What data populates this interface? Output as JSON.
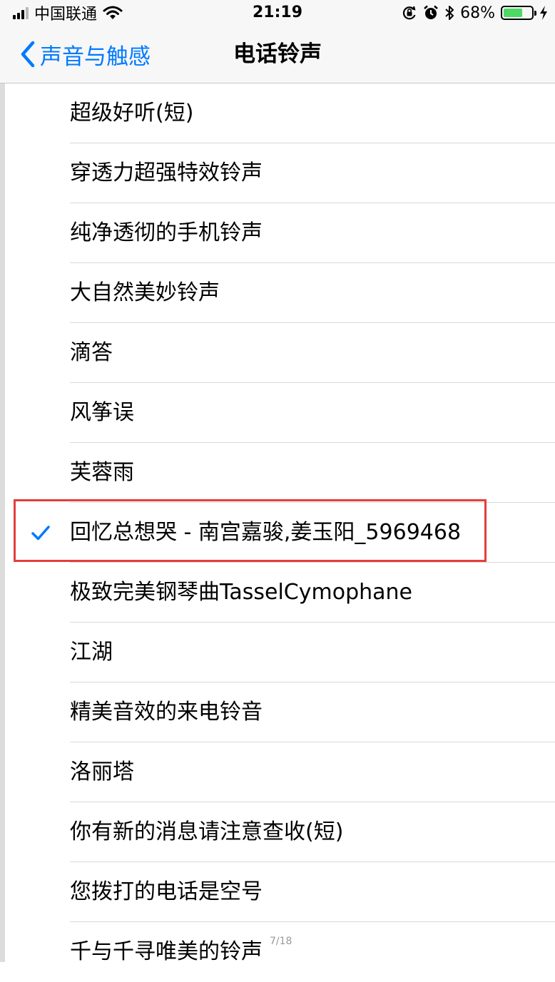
{
  "status_bar": {
    "carrier": "中国联通",
    "time": "21:19",
    "battery_percent": "68%",
    "battery_level": 0.68,
    "icons": [
      "signal-icon",
      "wifi-icon",
      "orientation-lock-icon",
      "alarm-icon",
      "bluetooth-icon",
      "battery-icon",
      "charging-icon"
    ]
  },
  "nav": {
    "back_label": "声音与触感",
    "title": "电话铃声"
  },
  "ringtones": [
    {
      "label": "超级好听(短)",
      "selected": false
    },
    {
      "label": "穿透力超强特效铃声",
      "selected": false
    },
    {
      "label": "纯净透彻的手机铃声",
      "selected": false
    },
    {
      "label": "大自然美妙铃声",
      "selected": false
    },
    {
      "label": "滴答",
      "selected": false
    },
    {
      "label": "风筝误",
      "selected": false
    },
    {
      "label": "芙蓉雨",
      "selected": false
    },
    {
      "label": "回忆总想哭 - 南宫嘉骏,姜玉阳_5969468",
      "selected": true
    },
    {
      "label": "极致完美钢琴曲TasselCymophane",
      "selected": false
    },
    {
      "label": "江湖",
      "selected": false
    },
    {
      "label": "精美音效的来电铃音",
      "selected": false
    },
    {
      "label": "洛丽塔",
      "selected": false
    },
    {
      "label": "你有新的消息请注意查收(短)",
      "selected": false
    },
    {
      "label": "您拨打的电话是空号",
      "selected": false
    },
    {
      "label": "千与千寻唯美的铃声",
      "selected": false
    }
  ],
  "page_indicator": "7/18",
  "colors": {
    "accent": "#007aff",
    "highlight_border": "#e23f3b",
    "battery_fill": "#4cd964"
  }
}
